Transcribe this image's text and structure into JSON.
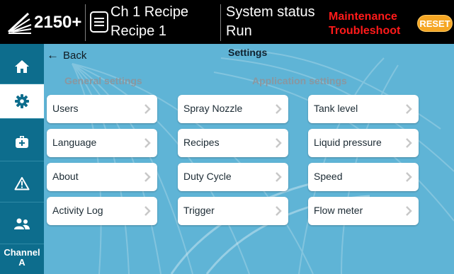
{
  "header": {
    "model": "2150+",
    "recipe_title": "Ch 1 Recipe",
    "recipe_name": "Recipe 1",
    "system_title": "System status",
    "system_value": "Run",
    "maintenance_line1": "Maintenance",
    "maintenance_line2": "Troubleshoot",
    "reset_label": "RESET",
    "maintenance_color": "#ff1a1a",
    "reset_color": "#f5a623"
  },
  "sidebar": {
    "items": [
      {
        "icon": "home-icon"
      },
      {
        "icon": "gear-icon"
      },
      {
        "icon": "toolbox-icon"
      },
      {
        "icon": "warning-icon"
      },
      {
        "icon": "users-icon"
      }
    ],
    "channel_line1": "Channel",
    "channel_line2": "A"
  },
  "page": {
    "back_label": "Back",
    "title": "Settings",
    "general_title": "General settings",
    "application_title": "Application settings"
  },
  "general_buttons": [
    "Users",
    "Language",
    "About",
    "Activity Log"
  ],
  "application_col1": [
    "Spray Nozzle",
    "Recipes",
    "Duty Cycle",
    "Trigger"
  ],
  "application_col2": [
    "Tank level",
    "Liquid pressure",
    "Speed",
    "Flow meter"
  ]
}
